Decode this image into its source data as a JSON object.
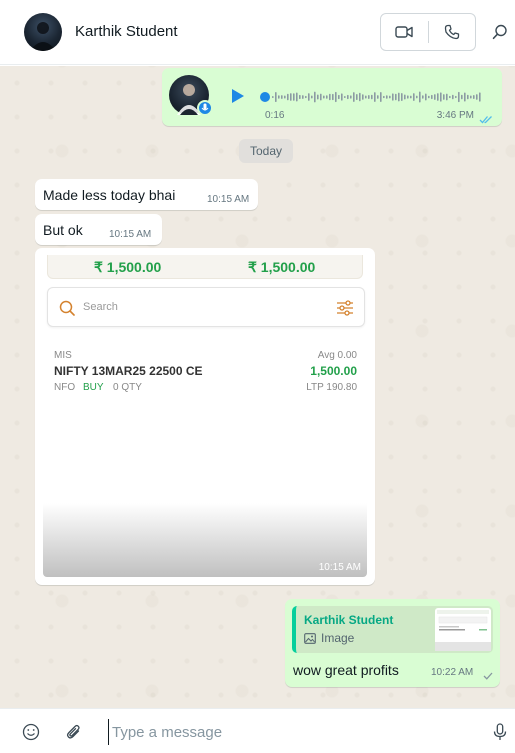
{
  "header": {
    "contact_name": "Karthik Student",
    "video_call_icon": "video-icon",
    "voice_call_icon": "phone-icon",
    "search_icon": "search-icon"
  },
  "messages": {
    "voice": {
      "duration": "0:16",
      "time": "3:46 PM",
      "status_icon": "double-check-icon"
    },
    "date_separator": "Today",
    "text1": {
      "text": "Made less today bhai",
      "time": "10:15 AM"
    },
    "text2": {
      "text": "But ok",
      "time": "10:15 AM"
    },
    "image": {
      "time": "10:15 AM",
      "screenshot": {
        "amount_left": "₹ 1,500.00",
        "amount_right": "₹ 1,500.00",
        "search_placeholder": "Search",
        "product": "MIS",
        "avg_label": "Avg 0.00",
        "symbol": "NIFTY 13MAR25 22500 CE",
        "pnl": "1,500.00",
        "exchange": "NFO",
        "side": "BUY",
        "qty": "0 QTY",
        "ltp": "LTP 190.80"
      }
    },
    "reply": {
      "quoted_name": "Karthik Student",
      "quoted_type": "Image",
      "text": "wow great profits",
      "time": "10:22 AM",
      "status_icon": "check-icon"
    }
  },
  "composer": {
    "placeholder": "Type a message",
    "emoji_icon": "emoji-icon",
    "attach_icon": "paperclip-icon",
    "mic_icon": "microphone-icon"
  },
  "colors": {
    "outgoing_bubble": "#d9fdd3",
    "incoming_bubble": "#ffffff",
    "chat_background": "#efeae2",
    "accent_blue": "#1e88e5",
    "profit_green": "#22a04a"
  }
}
